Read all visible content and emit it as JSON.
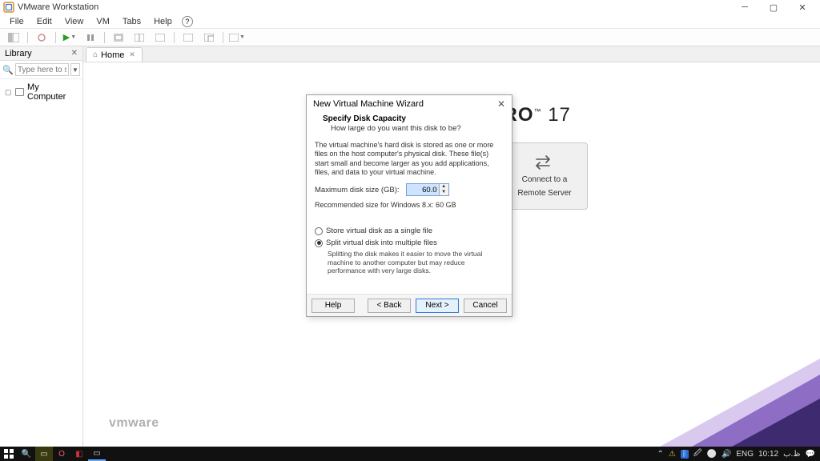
{
  "titlebar": {
    "title": "VMware Workstation"
  },
  "menu": {
    "file": "File",
    "edit": "Edit",
    "view": "View",
    "vm": "VM",
    "tabs": "Tabs",
    "help": "Help"
  },
  "library": {
    "title": "Library",
    "search_placeholder": "Type here to sea...",
    "my_computer": "My Computer"
  },
  "tabs": {
    "home": "Home"
  },
  "home": {
    "brand_strong": "WORKSTATION PRO",
    "brand_suffix": " 17",
    "vmware": "vmware",
    "tile_connect_line1": "Connect to a",
    "tile_connect_line2": "Remote Server"
  },
  "dialog": {
    "title": "New Virtual Machine Wizard",
    "heading": "Specify Disk Capacity",
    "subheading": "How large do you want this disk to be?",
    "para": "The virtual machine's hard disk is stored as one or more files on the host computer's physical disk. These file(s) start small and become larger as you add applications, files, and data to your virtual machine.",
    "max_label": "Maximum disk size (GB):",
    "max_value": "60.0",
    "recommended": "Recommended size for Windows 8.x: 60 GB",
    "radio_single": "Store virtual disk as a single file",
    "radio_split": "Split virtual disk into multiple files",
    "split_note": "Splitting the disk makes it easier to move the virtual machine to another computer but may reduce performance with very large disks.",
    "btn_help": "Help",
    "btn_back": "< Back",
    "btn_next": "Next >",
    "btn_cancel": "Cancel"
  },
  "taskbar": {
    "lang": "ENG",
    "time": "10:12",
    "arabic": "ظ.ب"
  }
}
